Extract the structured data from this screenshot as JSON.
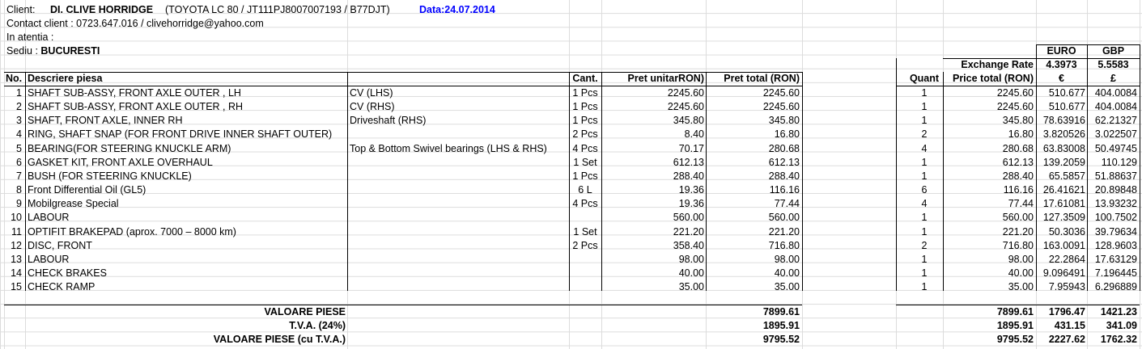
{
  "header": {
    "client_label": "Client:",
    "client_name": "DI. CLIVE HORRIDGE",
    "vehicle": "(TOYOTA LC 80 / JT111PJ8007007193 / B77DJT)",
    "date": "Data:24.07.2014",
    "contact": "Contact client :  0723.647.016 / clivehorridge@yahoo.com",
    "attention": "In atentia :",
    "sediu_label": "Sediu :",
    "sediu_value": "BUCURESTI"
  },
  "fx": {
    "euro_label": "EURO",
    "gbp_label": "GBP",
    "rate_label": "Exchange Rate",
    "euro_rate": "4.3973",
    "gbp_rate": "5.5583",
    "euro_symbol": "€",
    "gbp_symbol": "£"
  },
  "columns": {
    "no": "No.",
    "desc": "Descriere piesa",
    "cant": "Cant.",
    "unit": "Pret unitarRON)",
    "total": "Pret total (RON)",
    "quant": "Quant",
    "price_total": "Price total (RON)"
  },
  "rows": [
    {
      "no": "1",
      "desc": "SHAFT SUB-ASSY, FRONT AXLE OUTER , LH",
      "note": "CV (LHS)",
      "cant": "1 Pcs",
      "unit": "2245.60",
      "total": "2245.60",
      "quant": "1",
      "ptotal": "2245.60",
      "eur": "510.677",
      "gbp": "404.0084"
    },
    {
      "no": "2",
      "desc": "SHAFT SUB-ASSY, FRONT AXLE OUTER , RH",
      "note": "CV (RHS)",
      "cant": "1 Pcs",
      "unit": "2245.60",
      "total": "2245.60",
      "quant": "1",
      "ptotal": "2245.60",
      "eur": "510.677",
      "gbp": "404.0084"
    },
    {
      "no": "3",
      "desc": "SHAFT, FRONT AXLE, INNER RH",
      "note": "Driveshaft (RHS)",
      "cant": "1 Pcs",
      "unit": "345.80",
      "total": "345.80",
      "quant": "1",
      "ptotal": "345.80",
      "eur": "78.63916",
      "gbp": "62.21327"
    },
    {
      "no": "4",
      "desc": "RING, SHAFT SNAP (FOR FRONT DRIVE INNER SHAFT OUTER)",
      "note": "",
      "cant": "2 Pcs",
      "unit": "8.40",
      "total": "16.80",
      "quant": "2",
      "ptotal": "16.80",
      "eur": "3.820526",
      "gbp": "3.022507"
    },
    {
      "no": "5",
      "desc": "BEARING(FOR STEERING KNUCKLE ARM)",
      "note": "Top & Bottom Swivel bearings (LHS & RHS)",
      "cant": "4 Pcs",
      "unit": "70.17",
      "total": "280.68",
      "quant": "4",
      "ptotal": "280.68",
      "eur": "63.83008",
      "gbp": "50.49745"
    },
    {
      "no": "6",
      "desc": "GASKET KIT, FRONT AXLE OVERHAUL",
      "note": "",
      "cant": "1 Set",
      "unit": "612.13",
      "total": "612.13",
      "quant": "1",
      "ptotal": "612.13",
      "eur": "139.2059",
      "gbp": "110.129"
    },
    {
      "no": "7",
      "desc": "BUSH (FOR STEERING KNUCKLE)",
      "note": "",
      "cant": "1 Pcs",
      "unit": "288.40",
      "total": "288.40",
      "quant": "1",
      "ptotal": "288.40",
      "eur": "65.5857",
      "gbp": "51.88637"
    },
    {
      "no": "8",
      "desc": "Front Differential Oil (GL5)",
      "note": "",
      "cant": "6 L",
      "unit": "19.36",
      "total": "116.16",
      "quant": "6",
      "ptotal": "116.16",
      "eur": "26.41621",
      "gbp": "20.89848"
    },
    {
      "no": "9",
      "desc": "Mobilgrease Special",
      "note": "",
      "cant": "4 Pcs",
      "unit": "19.36",
      "total": "77.44",
      "quant": "4",
      "ptotal": "77.44",
      "eur": "17.61081",
      "gbp": "13.93232"
    },
    {
      "no": "10",
      "desc": "LABOUR",
      "note": "",
      "cant": "",
      "unit": "560.00",
      "total": "560.00",
      "quant": "1",
      "ptotal": "560.00",
      "eur": "127.3509",
      "gbp": "100.7502"
    },
    {
      "no": "11",
      "desc": "OPTIFIT BRAKEPAD (aprox. 7000 – 8000 km)",
      "note": "",
      "cant": "1 Set",
      "unit": "221.20",
      "total": "221.20",
      "quant": "1",
      "ptotal": "221.20",
      "eur": "50.3036",
      "gbp": "39.79634"
    },
    {
      "no": "12",
      "desc": "DISC, FRONT",
      "note": "",
      "cant": "2 Pcs",
      "unit": "358.40",
      "total": "716.80",
      "quant": "2",
      "ptotal": "716.80",
      "eur": "163.0091",
      "gbp": "128.9603"
    },
    {
      "no": "13",
      "desc": "LABOUR",
      "note": "",
      "cant": "",
      "unit": "98.00",
      "total": "98.00",
      "quant": "1",
      "ptotal": "98.00",
      "eur": "22.2864",
      "gbp": "17.63129"
    },
    {
      "no": "14",
      "desc": "CHECK BRAKES",
      "note": "",
      "cant": "",
      "unit": "40.00",
      "total": "40.00",
      "quant": "1",
      "ptotal": "40.00",
      "eur": "9.096491",
      "gbp": "7.196445"
    },
    {
      "no": "15",
      "desc": "CHECK RAMP",
      "note": "",
      "cant": "",
      "unit": "35.00",
      "total": "35.00",
      "quant": "1",
      "ptotal": "35.00",
      "eur": "7.95943",
      "gbp": "6.296889"
    }
  ],
  "totals": [
    {
      "label": "VALOARE PIESE",
      "ron": "7899.61",
      "ptotal": "7899.61",
      "eur": "1796.47",
      "gbp": "1421.23"
    },
    {
      "label": "T.V.A. (24%)",
      "ron": "1895.91",
      "ptotal": "1895.91",
      "eur": "431.15",
      "gbp": "341.09"
    },
    {
      "label": "VALOARE PIESE (cu T.V.A.)",
      "ron": "9795.52",
      "ptotal": "9795.52",
      "eur": "2227.62",
      "gbp": "1762.32"
    }
  ]
}
